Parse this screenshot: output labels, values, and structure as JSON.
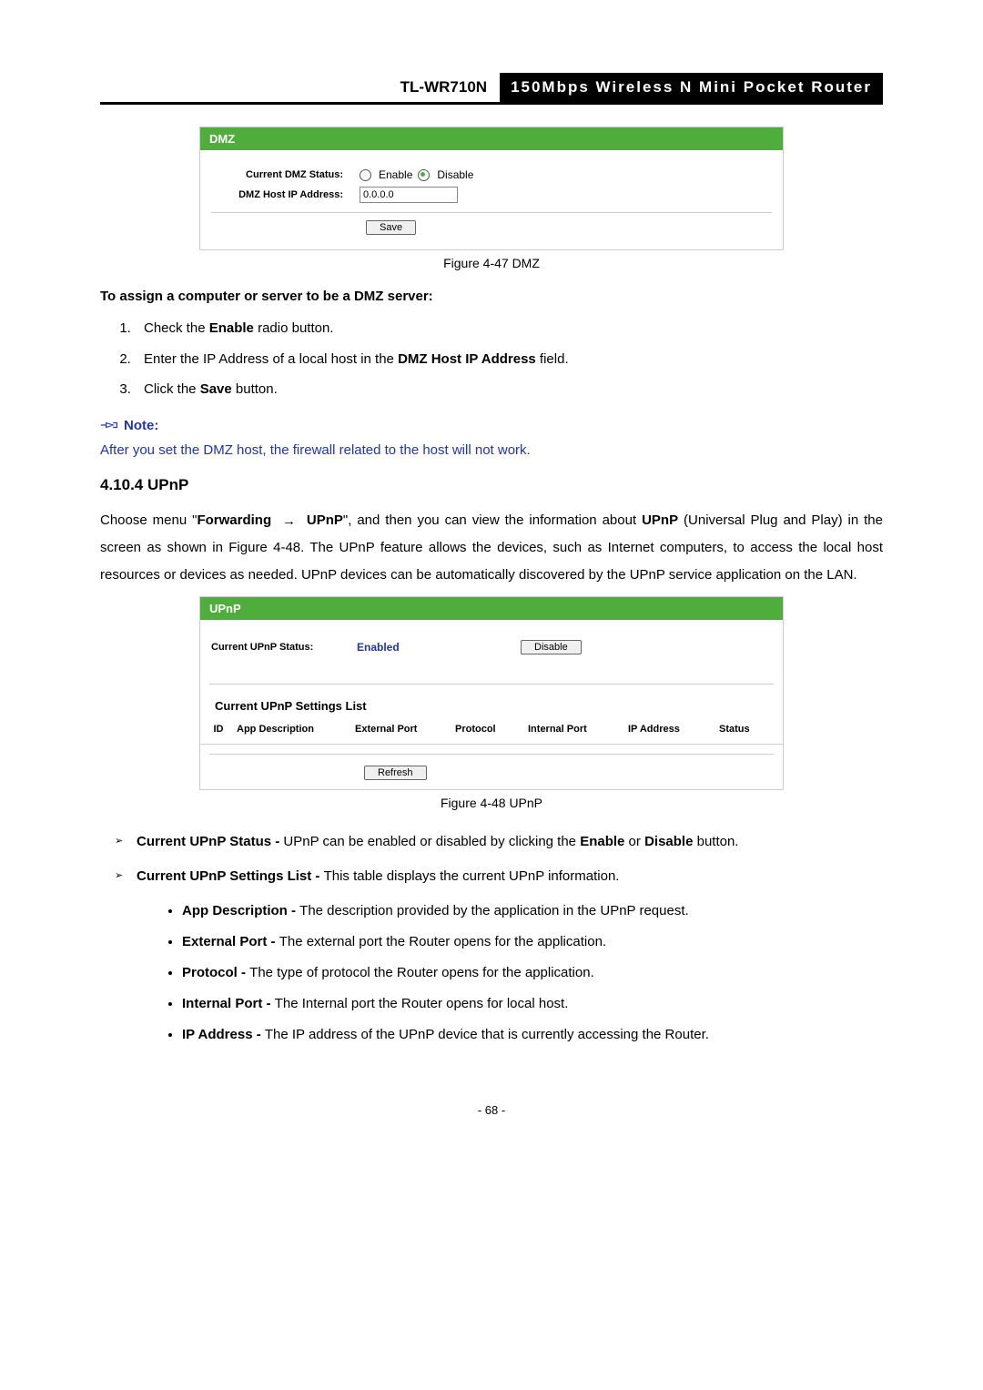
{
  "header": {
    "model": "TL-WR710N",
    "desc": "150Mbps  Wireless  N  Mini  Pocket  Router"
  },
  "dmz_panel": {
    "title": "DMZ",
    "status_label": "Current DMZ Status:",
    "enable": "Enable",
    "disable": "Disable",
    "host_label": "DMZ Host IP Address:",
    "host_value": "0.0.0.0",
    "save": "Save"
  },
  "fig47": "Figure 4-47    DMZ",
  "instr_head": "To assign a computer or server to be a DMZ server:",
  "steps": {
    "s1_pre": "Check the ",
    "s1_bold": "Enable",
    "s1_post": " radio button.",
    "s2_pre": "Enter the IP Address of a local host in the ",
    "s2_bold": "DMZ Host IP Address",
    "s2_post": " field.",
    "s3_pre": "Click the ",
    "s3_bold": "Save",
    "s3_post": " button."
  },
  "note": {
    "head": "Note:",
    "body": "After you set the DMZ host, the firewall related to the host will not work."
  },
  "section": {
    "num": "4.10.4",
    "title": "UPnP"
  },
  "upnp_para": {
    "p1": "Choose  menu  \"",
    "p1_b1": "Forwarding",
    "arrow": "→",
    "p1_b2": "UPnP",
    "p1_mid": "\",  and  then  you  can  view  the  information  about ",
    "p1_b3": "UPnP",
    "p2": " (Universal Plug and Play) in the screen as shown in Figure 4-48. The UPnP feature allows the devices, such as Internet computers, to access the local host resources or devices as needed. UPnP devices can be automatically discovered by the UPnP service application on the LAN."
  },
  "upnp_panel": {
    "title": "UPnP",
    "status_label": "Current UPnP Status:",
    "status_value": "Enabled",
    "disable_btn": "Disable",
    "list_title": "Current UPnP Settings List",
    "th": [
      "ID",
      "App Description",
      "External Port",
      "Protocol",
      "Internal Port",
      "IP Address",
      "Status"
    ],
    "refresh": "Refresh"
  },
  "fig48": "Figure 4-48 UPnP",
  "bullets": {
    "b1_b": "Current UPnP Status - ",
    "b1_t1": "UPnP can be enabled or disabled by clicking the ",
    "b1_en": "Enable",
    "b1_or": " or ",
    "b1_dis": "Disable",
    "b1_post": " button.",
    "b2_b": "Current UPnP Settings List - ",
    "b2_t": "This table displays the current UPnP information.",
    "d1_b": "App Description - ",
    "d1_t": "The description provided by the application in the UPnP request.",
    "d2_b": "External Port - ",
    "d2_t": "The external port the Router opens for the application.",
    "d3_b": "Protocol - ",
    "d3_t": "The type of protocol the Router opens for the application.",
    "d4_b": "Internal Port - ",
    "d4_t": "The Internal port the Router opens for local host.",
    "d5_b": "IP Address - ",
    "d5_t": "The IP address of the UPnP device that is currently accessing the Router."
  },
  "pagenum": "- 68 -"
}
